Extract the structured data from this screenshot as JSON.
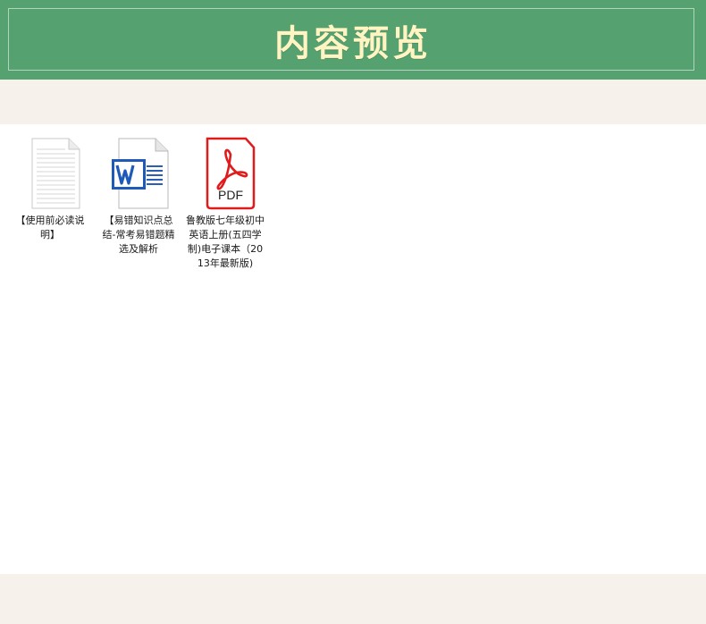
{
  "header": {
    "title": "内容预览",
    "colors": {
      "background": "#56a170",
      "title": "#fff4c2"
    }
  },
  "files": [
    {
      "icon": "text-document-icon",
      "name": "【使用前必读说明】"
    },
    {
      "icon": "word-document-icon",
      "name": "【易错知识点总结-常考易错题精选及解析"
    },
    {
      "icon": "pdf-document-icon",
      "name": "鲁教版七年级初中英语上册(五四学制)电子课本（2013年最新版)"
    }
  ]
}
